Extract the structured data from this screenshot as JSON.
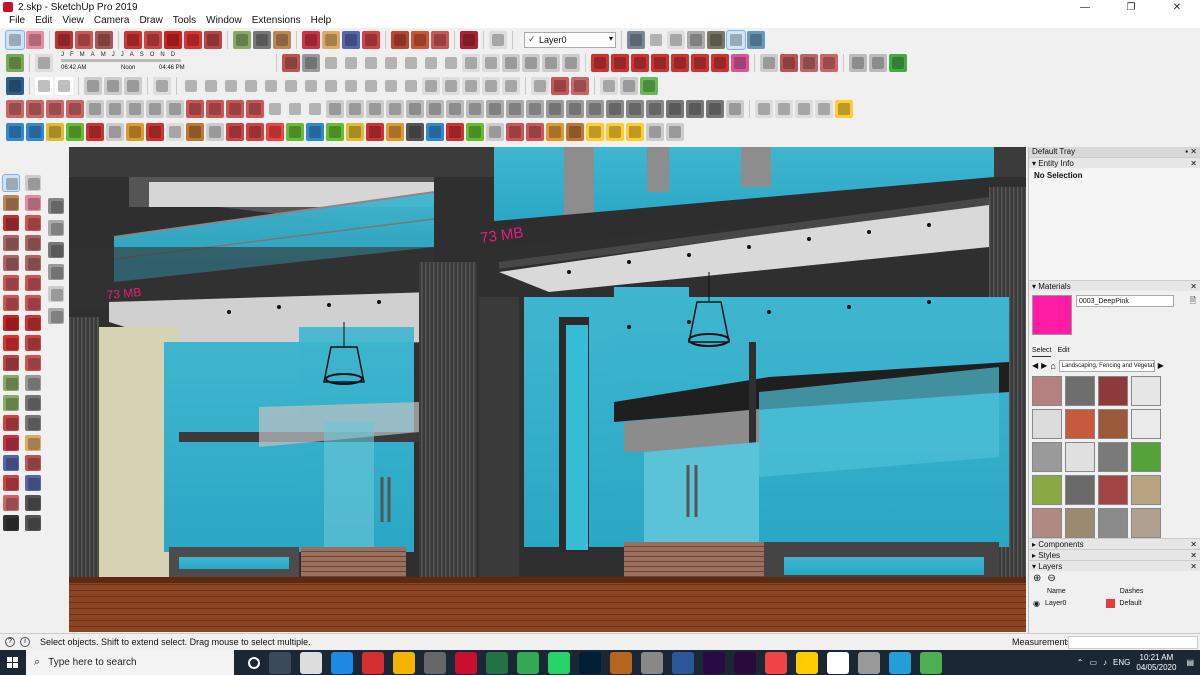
{
  "window": {
    "title": "2.skp - SketchUp Pro 2019",
    "controls": [
      "—",
      "❐",
      "✕"
    ]
  },
  "menu": [
    "File",
    "Edit",
    "View",
    "Camera",
    "Draw",
    "Tools",
    "Window",
    "Extensions",
    "Help"
  ],
  "toolbar": {
    "layer_current": "Layer0",
    "shadow_months": [
      "J",
      "F",
      "M",
      "A",
      "M",
      "J",
      "J",
      "A",
      "S",
      "O",
      "N",
      "D"
    ],
    "shadow_time_start": "06:42 AM",
    "shadow_time_noon": "Noon",
    "shadow_time_end": "04:46 PM"
  },
  "scene": {
    "sign_upper": "73 MB",
    "sign_lower": "73 MB"
  },
  "tray": {
    "title": "Default Tray",
    "entity_info": {
      "header": "Entity Info",
      "selection": "No Selection"
    },
    "materials": {
      "header": "Materials",
      "current_name": "0003_DeepPink",
      "current_color": "#ff1ca4",
      "tab_select": "Select",
      "tab_edit": "Edit",
      "library": "Landscaping, Fencing and Vegetation"
    },
    "components": {
      "header": "Components"
    },
    "styles": {
      "header": "Styles"
    },
    "layers": {
      "header": "Layers",
      "col_name": "Name",
      "col_dashes": "Dashes",
      "row_name": "Layer0",
      "row_dashes": "Default"
    }
  },
  "status": {
    "text": "Select objects. Shift to extend select. Drag mouse to select multiple.",
    "measurements_label": "Measurements"
  },
  "taskbar": {
    "search_placeholder": "Type here to search",
    "language": "ENG",
    "time": "10:21 AM",
    "date": "04/05/2020"
  }
}
